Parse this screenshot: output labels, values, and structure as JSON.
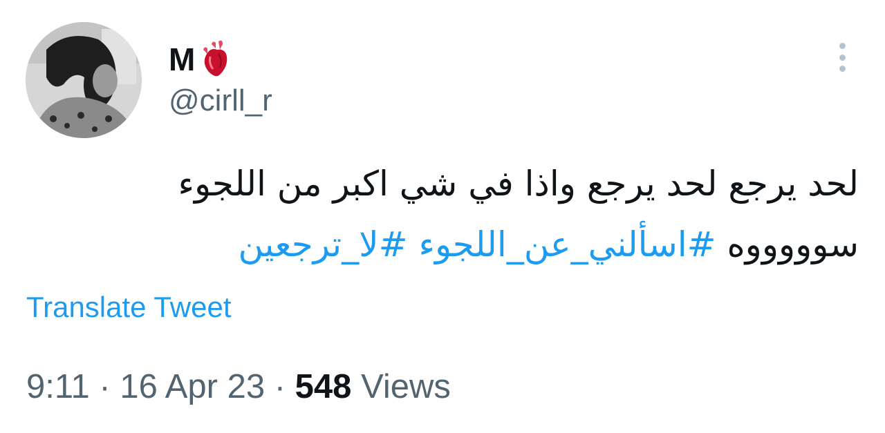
{
  "author": {
    "display_name": "M",
    "name_emoji": "anatomical-heart-icon",
    "handle": "@cirll_r",
    "avatar": "profile-photo"
  },
  "tweet": {
    "text_line_1": "لحد يرجع لحد يرجع واذا في شي اكبر من اللجوء",
    "text_line_2_prefix": "سوووووه",
    "hashtags": [
      "#اسألني_عن_اللجوء",
      "#لا_ترجعين"
    ]
  },
  "actions": {
    "translate_label": "Translate Tweet",
    "more_icon": "more-vertical-icon"
  },
  "meta": {
    "time": "9:11",
    "separator": "·",
    "date": "16 Apr 23",
    "views_count": "548",
    "views_label": "Views"
  },
  "colors": {
    "text": "#0f1419",
    "secondary": "#536471",
    "link": "#1d9bf0",
    "icon_gray": "#b8c2cb"
  }
}
